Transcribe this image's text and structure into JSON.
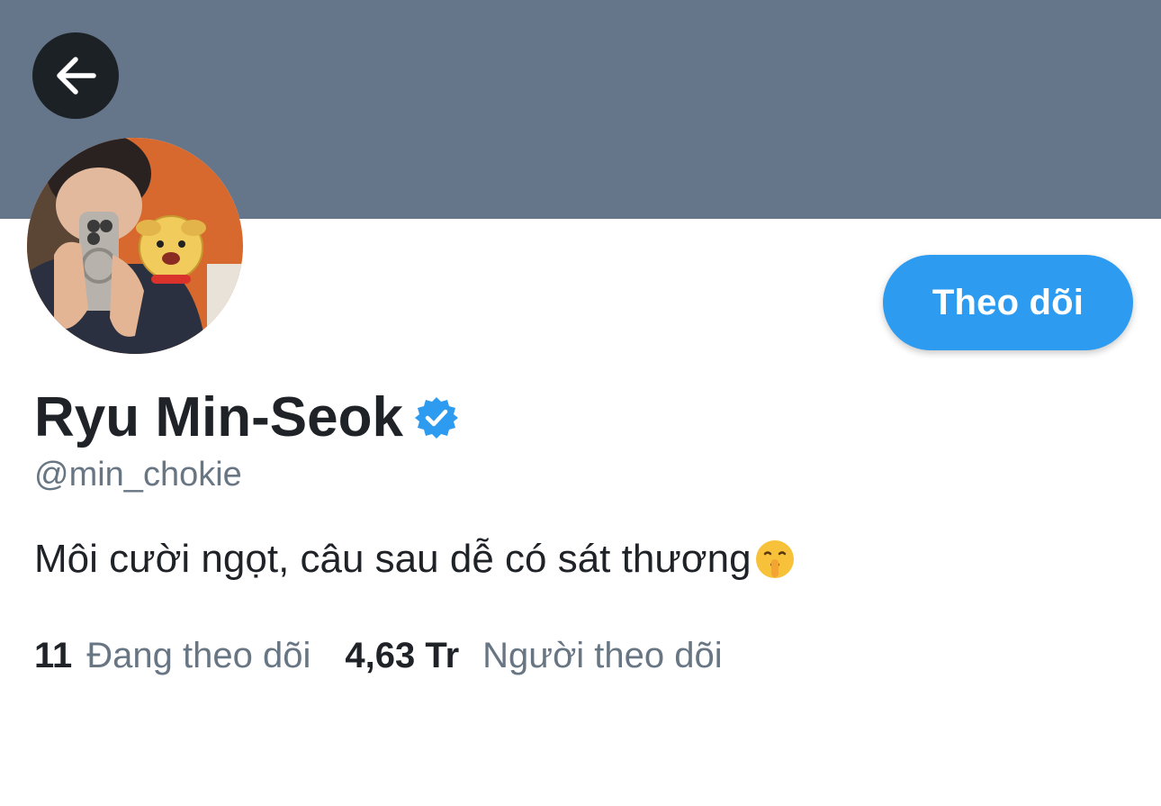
{
  "header": {
    "back_icon": "arrow-left-icon",
    "banner_color": "#66768a"
  },
  "profile": {
    "avatar_icon": "profile-photo",
    "display_name": "Ryu Min-Seok",
    "verified_icon": "verified-badge-icon",
    "verified_color": "#2d9bf0",
    "handle": "@min_chokie",
    "bio": "Môi cười ngọt, câu sau dễ có sát thương",
    "bio_emoji_icon": "shushing-face-emoji"
  },
  "actions": {
    "follow_label": "Theo dõi",
    "follow_color": "#2d9bf0"
  },
  "stats": {
    "following_count": "11",
    "following_label": "Đang theo dõi",
    "followers_count": "4,63 Tr",
    "followers_label": "Người theo dõi"
  }
}
